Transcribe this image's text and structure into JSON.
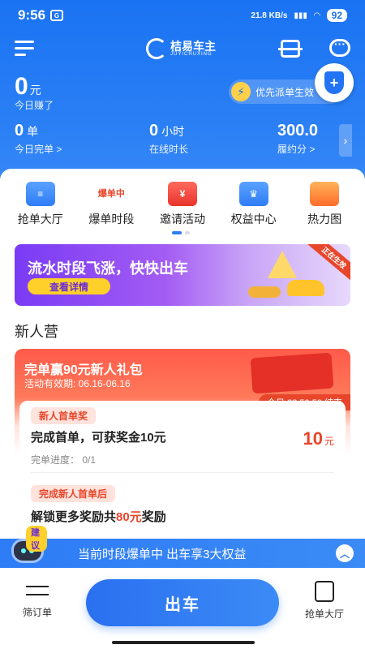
{
  "status_bar": {
    "time": "9:56",
    "app_badge": "G",
    "net_speed": "21.8 KB/s",
    "battery": "92"
  },
  "header": {
    "brand_name": "桔易车主",
    "brand_pinyin": "JUYICHUXING"
  },
  "earnings": {
    "value": "0",
    "unit": "元",
    "label": "今日赚了"
  },
  "priority": {
    "label": "优先派单生效"
  },
  "stats": [
    {
      "value": "0",
      "unit": "单",
      "label": "今日完单 >"
    },
    {
      "value": "0",
      "unit": "小时",
      "label": "在线时长"
    },
    {
      "value": "300.0",
      "unit": "",
      "label": "履约分 >"
    }
  ],
  "quick_menu": [
    {
      "label": "抢单大厅",
      "icon": "grab-hall-icon"
    },
    {
      "label": "爆单时段",
      "icon": "burst-period-icon",
      "icon_text": "爆单中"
    },
    {
      "label": "邀请活动",
      "icon": "invite-icon",
      "icon_text": "¥"
    },
    {
      "label": "权益中心",
      "icon": "crown-icon"
    },
    {
      "label": "热力图",
      "icon": "heatmap-icon"
    }
  ],
  "banner": {
    "title": "流水时段飞涨，快快出车",
    "button": "查看详情",
    "tag": "正在生效"
  },
  "section": {
    "title": "新人营"
  },
  "newbie": {
    "title": "完单赢90元新人礼包",
    "validity": "活动有效期: 06.16-06.16",
    "countdown": "今日 23:59:59 结束",
    "task1": {
      "chip": "新人首单奖",
      "text": "完成首单，可获奖金10元",
      "reward": "10",
      "reward_unit": "元",
      "progress": "完单进度： 0/1"
    },
    "task2": {
      "chip": "完成新人首单后",
      "text_prefix": "解锁更多奖励共",
      "text_highlight": "80元",
      "text_suffix": "奖励"
    }
  },
  "tip_bar": {
    "text": "当前时段爆单中 出车享3大权益",
    "robot_bubble": "建议"
  },
  "bottom_nav": {
    "filter_label": "筛订单",
    "go_label": "出车",
    "grab_label": "抢单大厅"
  },
  "colors": {
    "primary": "#2e7cf6",
    "accent_red": "#e8462b",
    "banner_purple": "#7a3bf5",
    "button_yellow": "#ffd02a"
  }
}
